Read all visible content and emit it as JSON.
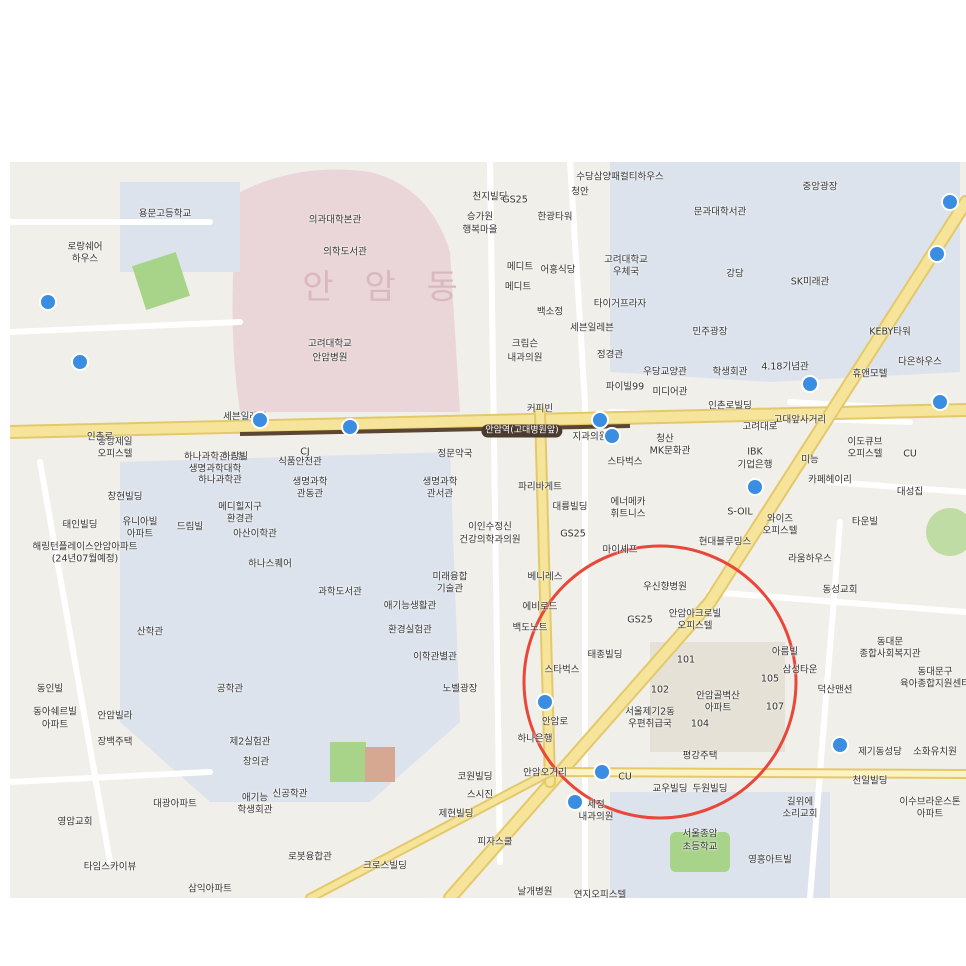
{
  "map": {
    "district": "안 암 동",
    "station_label": "안암역(고대병원앞)",
    "highlight": {
      "shape": "circle",
      "color": "#e8473a"
    },
    "colors": {
      "road_main": "#f6e49a",
      "road_edge": "#e3c96a",
      "campus": "#ead6d8",
      "block": "#dde3ec",
      "background": "#f1efe9",
      "bus": "#3a8de0",
      "circle": "#e8473a",
      "subway": "#5a4633"
    },
    "labels": [
      {
        "t": "수당삼양패컬티하우스"
      },
      {
        "t": "중앙광장"
      },
      {
        "t": "천지빌딩"
      },
      {
        "t": "청안"
      },
      {
        "t": "GS25"
      },
      {
        "t": "한광타워"
      },
      {
        "t": "의과대학본관"
      },
      {
        "t": "승가원"
      },
      {
        "t": "행복마을"
      },
      {
        "t": "문과대학서관"
      },
      {
        "t": "의학도서관"
      },
      {
        "t": "메디트"
      },
      {
        "t": "어흥식당"
      },
      {
        "t": "고려대학교"
      },
      {
        "t": "우체국"
      },
      {
        "t": "강당"
      },
      {
        "t": "SK미래관"
      },
      {
        "t": "메디트"
      },
      {
        "t": "백소정"
      },
      {
        "t": "타이거프라자"
      },
      {
        "t": "세븐일레븐"
      },
      {
        "t": "민주광장"
      },
      {
        "t": "KEBY타워"
      },
      {
        "t": "고려대학교"
      },
      {
        "t": "안암병원"
      },
      {
        "t": "크림슨"
      },
      {
        "t": "내과의원"
      },
      {
        "t": "정경관"
      },
      {
        "t": "우당교양관"
      },
      {
        "t": "학생회관"
      },
      {
        "t": "4.18기념관"
      },
      {
        "t": "휴앤모텔"
      },
      {
        "t": "다온하우스"
      },
      {
        "t": "파이빌99"
      },
      {
        "t": "미디어관"
      },
      {
        "t": "인촌로빌딩"
      },
      {
        "t": "커피빈"
      },
      {
        "t": "고대앞사거리"
      },
      {
        "t": "정문약국"
      },
      {
        "t": "지과의원"
      },
      {
        "t": "청산"
      },
      {
        "t": "MK문화관"
      },
      {
        "t": "IBK"
      },
      {
        "t": "기업은행"
      },
      {
        "t": "이도큐브"
      },
      {
        "t": "오피스텔"
      },
      {
        "t": "미능"
      },
      {
        "t": "CU"
      },
      {
        "t": "스타벅스"
      },
      {
        "t": "카페헤이리"
      },
      {
        "t": "대성집"
      },
      {
        "t": "파리바게트"
      },
      {
        "t": "대륭빌딩"
      },
      {
        "t": "에너메카"
      },
      {
        "t": "휘트니스"
      },
      {
        "t": "S-OIL"
      },
      {
        "t": "와이즈"
      },
      {
        "t": "오피스텔"
      },
      {
        "t": "타운빌"
      },
      {
        "t": "이인수정신"
      },
      {
        "t": "건강의학과의원"
      },
      {
        "t": "GS25"
      },
      {
        "t": "마이셰프"
      },
      {
        "t": "현대블루밍스"
      },
      {
        "t": "라움하우스"
      },
      {
        "t": "베니레스"
      },
      {
        "t": "우신향병원"
      },
      {
        "t": "동성교회"
      },
      {
        "t": "에비로드"
      },
      {
        "t": "GS25"
      },
      {
        "t": "안암아크로빌"
      },
      {
        "t": "오피스텔"
      },
      {
        "t": "백도노트"
      },
      {
        "t": "동대문"
      },
      {
        "t": "종합사회복지관"
      },
      {
        "t": "태종빌딩"
      },
      {
        "t": "아름빌"
      },
      {
        "t": "삼성타운"
      },
      {
        "t": "동대문구"
      },
      {
        "t": "육아종합지원센터"
      },
      {
        "t": "스타벅스"
      },
      {
        "t": "101"
      },
      {
        "t": "105"
      },
      {
        "t": "안암골벽산"
      },
      {
        "t": "아파트"
      },
      {
        "t": "덕산맨션"
      },
      {
        "t": "102"
      },
      {
        "t": "107"
      },
      {
        "t": "서울제기2동"
      },
      {
        "t": "우편취급국"
      },
      {
        "t": "104"
      },
      {
        "t": "하나은행"
      },
      {
        "t": "평강주택"
      },
      {
        "t": "제기동성당"
      },
      {
        "t": "소화유치원"
      },
      {
        "t": "안암오거리"
      },
      {
        "t": "CU"
      },
      {
        "t": "천일빌딩"
      },
      {
        "t": "코원빌딩"
      },
      {
        "t": "스시진"
      },
      {
        "t": "교우빌딩"
      },
      {
        "t": "두원빌딩"
      },
      {
        "t": "길위에"
      },
      {
        "t": "소리교회"
      },
      {
        "t": "이수브라운스톤"
      },
      {
        "t": "아파트"
      },
      {
        "t": "세정"
      },
      {
        "t": "내과의원"
      },
      {
        "t": "제현빌딩"
      },
      {
        "t": "피자스쿨"
      },
      {
        "t": "서울종암"
      },
      {
        "t": "초등학교"
      },
      {
        "t": "영흥아트빌"
      },
      {
        "t": "크로스빌딩"
      },
      {
        "t": "날개병원"
      },
      {
        "t": "연지오피스텔"
      },
      {
        "t": "로봇융합관"
      },
      {
        "t": "삼익아파트"
      },
      {
        "t": "타임스카이뷰"
      },
      {
        "t": "영암교회"
      },
      {
        "t": "대광아파트"
      },
      {
        "t": "애기능"
      },
      {
        "t": "학생회관"
      },
      {
        "t": "신공학관"
      },
      {
        "t": "창의관"
      },
      {
        "t": "제2실험관"
      },
      {
        "t": "공학관"
      },
      {
        "t": "장백주택"
      },
      {
        "t": "안암빌라"
      },
      {
        "t": "동아쉐르빌"
      },
      {
        "t": "아파트"
      },
      {
        "t": "동인빌"
      },
      {
        "t": "산학관"
      },
      {
        "t": "노벨광장"
      },
      {
        "t": "이학관별관"
      },
      {
        "t": "환경실험관"
      },
      {
        "t": "애기능생활관"
      },
      {
        "t": "과학도서관"
      },
      {
        "t": "미래융합"
      },
      {
        "t": "기술관"
      },
      {
        "t": "하나스퀘어"
      },
      {
        "t": "아산이학관"
      },
      {
        "t": "메디힐지구"
      },
      {
        "t": "환경관"
      },
      {
        "t": "생명과학"
      },
      {
        "t": "관동관"
      },
      {
        "t": "생명과학"
      },
      {
        "t": "관서관"
      },
      {
        "t": "하나과학관"
      },
      {
        "t": "하나과학관 A동"
      },
      {
        "t": "생명과학대학"
      },
      {
        "t": "CJ"
      },
      {
        "t": "식품안전관"
      },
      {
        "t": "해링턴플레이스안암아파트"
      },
      {
        "t": "(24년07월예정)"
      },
      {
        "t": "중앙제일"
      },
      {
        "t": "오피스텔"
      },
      {
        "t": "세븐일레븐"
      },
      {
        "t": "유니아빌"
      },
      {
        "t": "아파트"
      },
      {
        "t": "드림빌"
      },
      {
        "t": "태인빌딩"
      },
      {
        "t": "창현빌딩"
      },
      {
        "t": "하랑빌"
      },
      {
        "t": "용문고등학교"
      },
      {
        "t": "로랑쉐어"
      },
      {
        "t": "하우스"
      },
      {
        "t": "인촌로"
      },
      {
        "t": "고려대로"
      },
      {
        "t": "안암로"
      }
    ]
  }
}
